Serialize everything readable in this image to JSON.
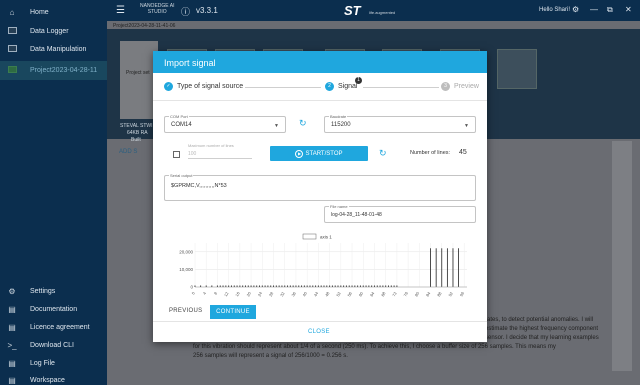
{
  "sidebar": {
    "items": [
      {
        "label": "Home",
        "icon": "home-icon"
      },
      {
        "label": "Data Logger",
        "icon": "data-logger-icon"
      },
      {
        "label": "Data Manipulation",
        "icon": "data-manipulation-icon"
      },
      {
        "label": "Project2023-04-28-11",
        "icon": "project-icon"
      }
    ],
    "bottom_items": [
      {
        "label": "Settings",
        "icon": "settings-icon"
      },
      {
        "label": "Documentation",
        "icon": "documentation-icon"
      },
      {
        "label": "Licence agreement",
        "icon": "licence-icon"
      },
      {
        "label": "Download CLI",
        "icon": "terminal-icon"
      },
      {
        "label": "Log File",
        "icon": "log-file-icon"
      },
      {
        "label": "Workspace",
        "icon": "workspace-icon"
      }
    ]
  },
  "topbar": {
    "brand_line1": "NANOEDGE AI",
    "brand_line2": "STUDIO",
    "version": "v3.3.1",
    "st_logo": "ST",
    "st_tagline": "life.augmented",
    "greeting": "Hello Shari!"
  },
  "background": {
    "project_title": "Project2023-04-28-11-41-06",
    "card_text": "Project set",
    "card_caption1": "STEVAL STWI",
    "card_caption2": "64KB RA",
    "card_caption3": "Built",
    "add_button": "ADD S",
    "text_right_1": "rates, to detect potential anomalies. I will",
    "text_right_2": "estimate the highest frequency component",
    "text_right_3": "sensor. I decide that my learning examples",
    "text_bottom_1": "for this vibration should represent about 1/4 of a second (250 ms). To achieve this, I choose a buffer size of 256 samples. This means my",
    "text_bottom_2": "256 samples will represent a signal of 256/1000 = 0.256 s."
  },
  "modal": {
    "title": "Import signal",
    "steps": [
      {
        "num": "1",
        "label": "Type of signal source",
        "state": "done"
      },
      {
        "num": "2",
        "label": "Signal",
        "state": "active"
      },
      {
        "num": "3",
        "label": "Preview",
        "state": "pending"
      }
    ],
    "step_badge": "1",
    "com_port": {
      "label": "COM Port",
      "value": "COM14"
    },
    "baudrate": {
      "label": "Baudrate",
      "value": "115200"
    },
    "max_lines": {
      "label": "Maximum number of lines",
      "value": "100"
    },
    "start_stop": "START/STOP",
    "number_of_lines_label": "Number of lines:",
    "number_of_lines_value": "45",
    "serial_output": {
      "label": "Serial output",
      "value": "$GPRMC,V,,,,,,,,,,N*53"
    },
    "file_name": {
      "label": "File name",
      "value": "log-04-28_11-48-01-48"
    },
    "buttons": {
      "previous": "PREVIOUS",
      "continue": "CONTINUE",
      "close": "CLOSE"
    },
    "accent_color": "#1fa7de"
  },
  "chart_data": {
    "type": "bar",
    "legend": [
      "axis 1"
    ],
    "yticks": [
      "20,000",
      "10,000",
      "0"
    ],
    "ylim": [
      0,
      25000
    ],
    "xticks": [
      "0",
      "4",
      "8",
      "12",
      "16",
      "20",
      "24",
      "28",
      "32",
      "36",
      "40",
      "44",
      "48",
      "52",
      "56",
      "60",
      "64",
      "68",
      "72",
      "76",
      "80",
      "84",
      "88",
      "92",
      "96"
    ],
    "categories": [
      84,
      86,
      88,
      90,
      92,
      94
    ],
    "values": [
      22000,
      22000,
      22000,
      22000,
      22000,
      22000
    ],
    "series": [
      {
        "name": "axis 1",
        "values": [
          22000,
          22000,
          22000,
          22000,
          22000,
          22000
        ]
      }
    ],
    "grid": true,
    "legend_position": "top"
  }
}
